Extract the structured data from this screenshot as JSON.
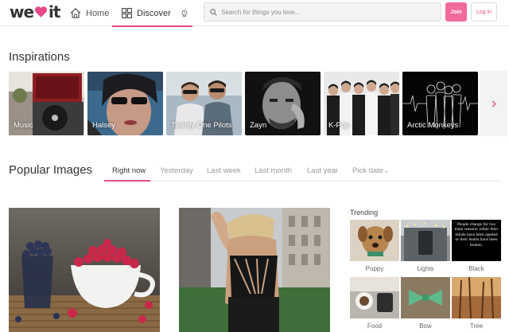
{
  "header": {
    "logo_we": "we",
    "logo_it": "it",
    "nav": [
      {
        "label": "Home",
        "icon": "home-icon"
      },
      {
        "label": "Discover",
        "icon": "grid-icon"
      },
      {
        "label": "",
        "icon": "lightbulb-icon"
      }
    ],
    "search_placeholder": "Search for things you love...",
    "join_label": "Join",
    "login_label": "Log in",
    "accent": "#f2699b"
  },
  "inspirations": {
    "title": "Inspirations",
    "items": [
      {
        "label": "Music"
      },
      {
        "label": "Halsey"
      },
      {
        "label": "Twenty One Pilots"
      },
      {
        "label": "Zayn"
      },
      {
        "label": "K-Pop"
      },
      {
        "label": "Arctic Monkeys"
      }
    ],
    "next_icon": "chevron-right-icon"
  },
  "popular": {
    "title": "Popular Images",
    "tabs": [
      {
        "label": "Right now",
        "active": true
      },
      {
        "label": "Yesterday"
      },
      {
        "label": "Last week"
      },
      {
        "label": "Last month"
      },
      {
        "label": "Last year"
      },
      {
        "label": "Pick date"
      }
    ],
    "pick_date_caret": "▸"
  },
  "trending": {
    "title": "Trending",
    "items": [
      {
        "label": "Puppy"
      },
      {
        "label": "Lights"
      },
      {
        "label": "Black",
        "quote": "People change for two main reasons: either their minds have been opened or their hearts have been broken."
      },
      {
        "label": "Food"
      },
      {
        "label": "Bow"
      },
      {
        "label": "Tree"
      }
    ]
  }
}
